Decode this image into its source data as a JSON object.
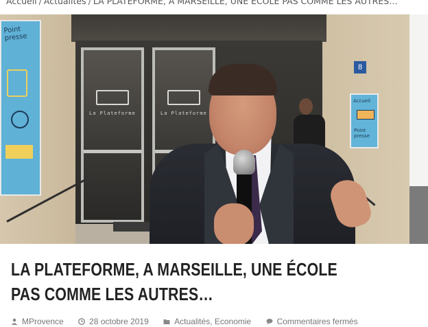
{
  "breadcrumb": {
    "items": [
      "Accueil",
      "Actualités",
      "LA PLATEFORME, A MARSEILLE, UNE ÉCOLE PAS COMME LES AUTRES…"
    ],
    "separator": "/"
  },
  "hero": {
    "poster_left_text": "Point presse",
    "poster_right_title": "Accueil",
    "poster_right_arrow": "Point presse",
    "door_sign": "La Plateforme",
    "street_number": "8"
  },
  "article": {
    "title": "LA PLATEFORME, A MARSEILLE, UNE ÉCOLE PAS COMME LES AUTRES…"
  },
  "meta": {
    "author": "MProvence",
    "date": "28 octobre 2019",
    "categories": [
      "Actualités",
      "Economie"
    ],
    "category_separator": ",",
    "comments": "Commentaires fermés"
  },
  "icons": {
    "author": "user-icon",
    "date": "clock-icon",
    "categories": "folder-icon",
    "comments": "comment-icon"
  },
  "colors": {
    "title": "#222222",
    "meta": "#777777",
    "poster_blue": "#5fb1d6"
  }
}
